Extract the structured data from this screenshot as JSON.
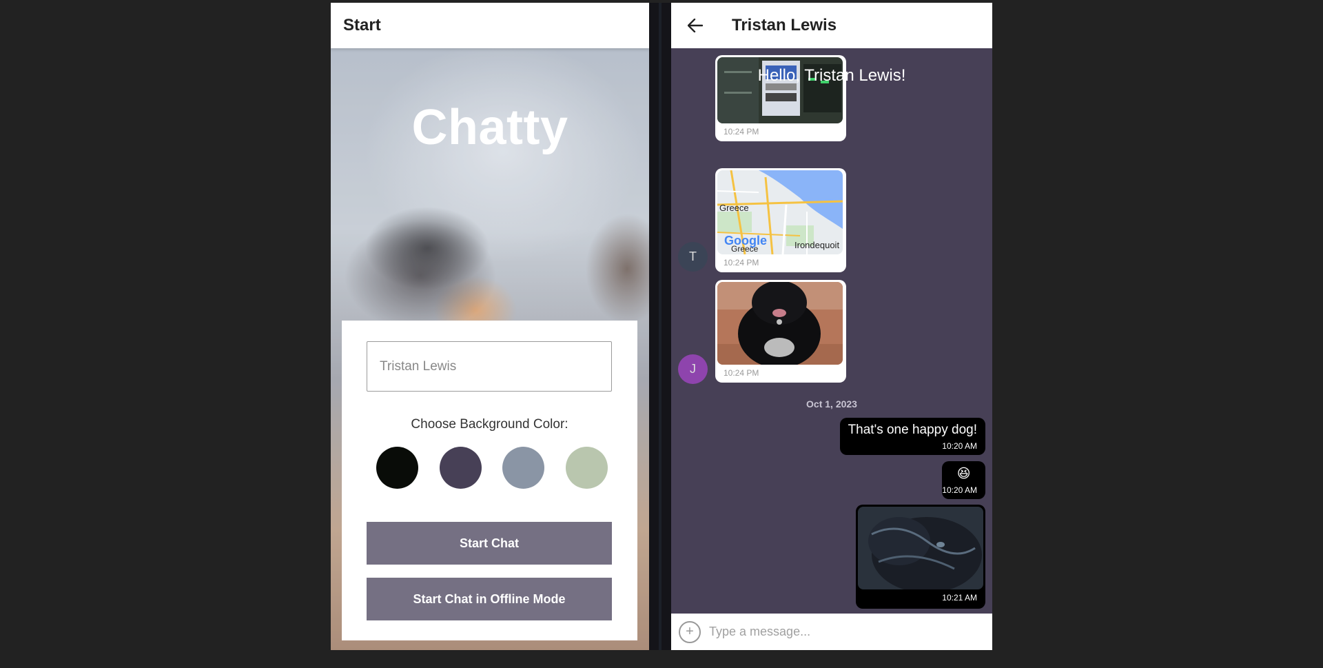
{
  "start_screen": {
    "appbar_title": "Start",
    "app_title": "Chatty",
    "name_input_placeholder": "Tristan Lewis",
    "color_label": "Choose Background Color:",
    "colors": [
      "#090C08",
      "#474056",
      "#8A95A5",
      "#B9C6AE"
    ],
    "start_chat_label": "Start Chat",
    "start_offline_label": "Start Chat in Offline Mode"
  },
  "chat_screen": {
    "appbar_title": "Tristan Lewis",
    "greeting": "Hello, Tristan Lewis!",
    "background_color": "#474056",
    "incoming": [
      {
        "content": "image",
        "time": "10:24 PM"
      },
      {
        "content": "map",
        "map_labels": [
          "Greece",
          "Greece",
          "Irondequoit"
        ],
        "map_brand": "Google",
        "time": "10:24 PM",
        "avatar": "T",
        "avatar_color": "#3b4456"
      },
      {
        "content": "image",
        "time": "10:24 PM",
        "avatar": "J",
        "avatar_color": "#8e44ad"
      }
    ],
    "date_separator": "Oct 1, 2023",
    "outgoing": [
      {
        "text": "That's one happy dog!",
        "time": "10:20 AM"
      },
      {
        "text": "😆",
        "time": "10:20 AM"
      },
      {
        "content": "image",
        "time": "10:21 AM"
      }
    ],
    "input_placeholder": "Type a message..."
  }
}
